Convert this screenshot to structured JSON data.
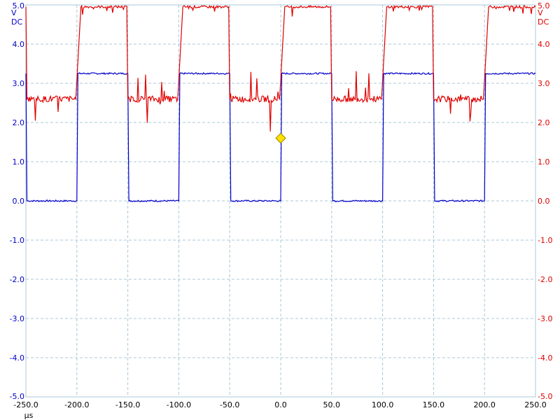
{
  "chart_data": {
    "type": "line",
    "xlabel": "µs",
    "xlim": [
      -250,
      250
    ],
    "xticks": [
      "-250.0",
      "-200.0",
      "-150.0",
      "-100.0",
      "-50.0",
      "0.0",
      "50.0",
      "100.0",
      "150.0",
      "200.0",
      "250.0"
    ],
    "y_axes": {
      "left": {
        "unit": "V",
        "coupling": "DC",
        "color": "#0000c8",
        "ylim": [
          -5,
          5
        ]
      },
      "right": {
        "unit": "V",
        "coupling": "DC",
        "color": "#e00000",
        "ylim": [
          -5,
          5
        ]
      }
    },
    "yticks": [
      "5.0",
      "4.0",
      "3.0",
      "2.0",
      "1.0",
      "0.0",
      "-1.0",
      "-2.0",
      "-3.0",
      "-4.0",
      "-5.0"
    ],
    "grid": true,
    "trigger": {
      "x": 0,
      "y": 1.6,
      "color": "#ffe000"
    },
    "series": [
      {
        "axis": "left",
        "color": "#0000c8",
        "high_level": 3.25,
        "low_level": 0.0,
        "x": [
          -250,
          -249,
          -200,
          -199,
          -150,
          -149,
          -100,
          -99,
          -50,
          -49,
          0,
          1,
          50,
          51,
          100,
          101,
          150,
          151,
          200,
          201,
          250
        ],
        "y": [
          3.25,
          0,
          0,
          3.25,
          3.25,
          0,
          0,
          3.25,
          3.25,
          0,
          0,
          3.25,
          3.25,
          0,
          0,
          3.25,
          3.25,
          0,
          0,
          3.25,
          3.25
        ]
      },
      {
        "axis": "right",
        "color": "#e00000",
        "high_level": 4.95,
        "low_level": 2.6,
        "x": [
          -250,
          -249,
          -201,
          -196,
          -151,
          -150,
          -101,
          -96,
          -51,
          -50,
          -1,
          4,
          49,
          50,
          99,
          104,
          149,
          150,
          199,
          204,
          250
        ],
        "y": [
          4.95,
          2.6,
          2.6,
          4.95,
          4.95,
          2.6,
          2.6,
          4.95,
          4.95,
          2.6,
          2.6,
          4.95,
          4.95,
          2.6,
          2.6,
          4.95,
          4.95,
          2.6,
          2.6,
          4.95,
          4.95
        ]
      }
    ]
  }
}
